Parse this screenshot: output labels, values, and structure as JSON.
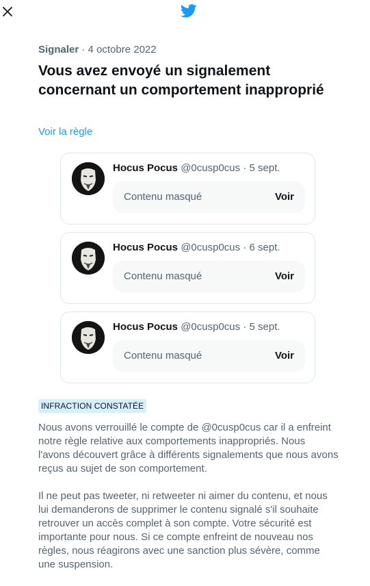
{
  "header": {
    "close_icon": "close-icon",
    "logo_icon": "twitter-bird-icon",
    "brand_color": "#1d9bf0"
  },
  "report": {
    "category": "Signaler",
    "separator": " · ",
    "date": "4 octobre 2022",
    "headline": "Vous avez envoyé un signalement concernant un comportement inapproprié",
    "rule_link": "Voir la règle"
  },
  "tweets": [
    {
      "name": "Hocus Pocus",
      "handle": "@0cusp0cus",
      "sep": " · ",
      "date": "5 sept.",
      "masked_label": "Contenu masqué",
      "view_label": "Voir"
    },
    {
      "name": "Hocus Pocus",
      "handle": "@0cusp0cus",
      "sep": " · ",
      "date": "6 sept.",
      "masked_label": "Contenu masqué",
      "view_label": "Voir"
    },
    {
      "name": "Hocus Pocus",
      "handle": "@0cusp0cus",
      "sep": " · ",
      "date": "5 sept.",
      "masked_label": "Contenu masqué",
      "view_label": "Voir"
    }
  ],
  "outcome": {
    "badge": "INFRACTION CONSTATÉE",
    "paragraph1": "Nous avons verrouillé le compte de @0cusp0cus car il a enfreint notre règle relative aux comportements inappropriés. Nous l'avons découvert grâce à différents signalements que nous avons reçus au sujet de son comportement.",
    "paragraph2": "Il ne peut pas tweeter, ni retweeter ni aimer du contenu, et nous lui demanderons de supprimer le contenu signalé s'il souhaite retrouver un accès complet à son compte. Votre sécurité est importante pour nous. Si ce compte enfreint de nouveau nos règles, nous réagirons avec une sanction plus sévère, comme une suspension."
  }
}
